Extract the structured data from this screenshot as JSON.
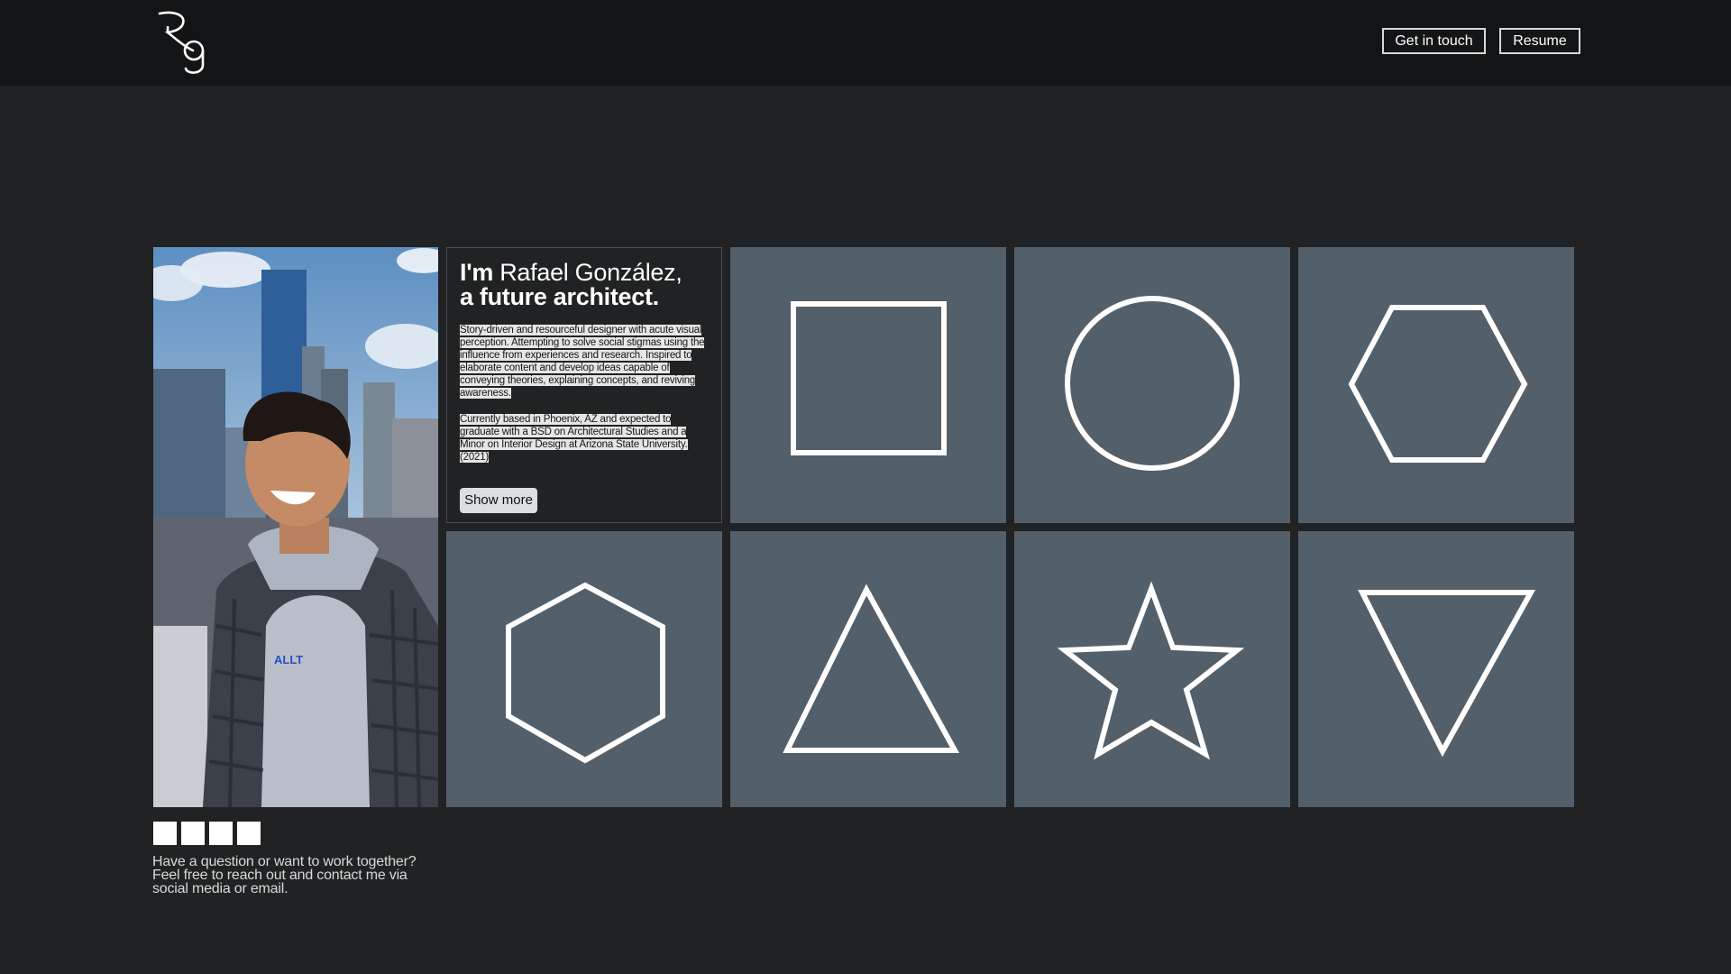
{
  "header": {
    "logo_text": "Rg",
    "get_in_touch": "Get in touch",
    "resume": "Resume"
  },
  "intro": {
    "title_im": "I'm",
    "title_name": " Rafael González,",
    "title_line2": "a future architect.",
    "paragraph1": "Story-driven and resourceful designer with acute visual perception. Attempting to solve social stigmas using the influence from experiences and research. Inspired to elaborate content and develop ideas capable of conveying theories, explaining concepts, and reviving awareness.",
    "paragraph2": "Currently based in Phoenix, AZ and expected to graduate with a BSD on Architectural Studies and a Minor on Interior Design at Arizona State University. (2021)",
    "show_more": "Show more"
  },
  "photo": {
    "hoodie_text": "ALLT"
  },
  "tiles": [
    {
      "shape": "square-icon"
    },
    {
      "shape": "circle-icon"
    },
    {
      "shape": "hexagon-icon"
    },
    {
      "shape": "hexagon-upright-icon"
    },
    {
      "shape": "triangle-icon"
    },
    {
      "shape": "star-icon"
    },
    {
      "shape": "inverted-triangle-icon"
    }
  ],
  "social_icons": [
    "social-icon-1",
    "social-icon-2",
    "social-icon-3",
    "social-icon-4"
  ],
  "contact": {
    "line1": "Have a question or want to work together?",
    "line2": "Feel free to reach out and contact me via",
    "line3": "social media or email."
  },
  "colors": {
    "background": "#202224",
    "topbar": "#131416",
    "tile": "#535f69",
    "shape_stroke": "#ffffff"
  }
}
